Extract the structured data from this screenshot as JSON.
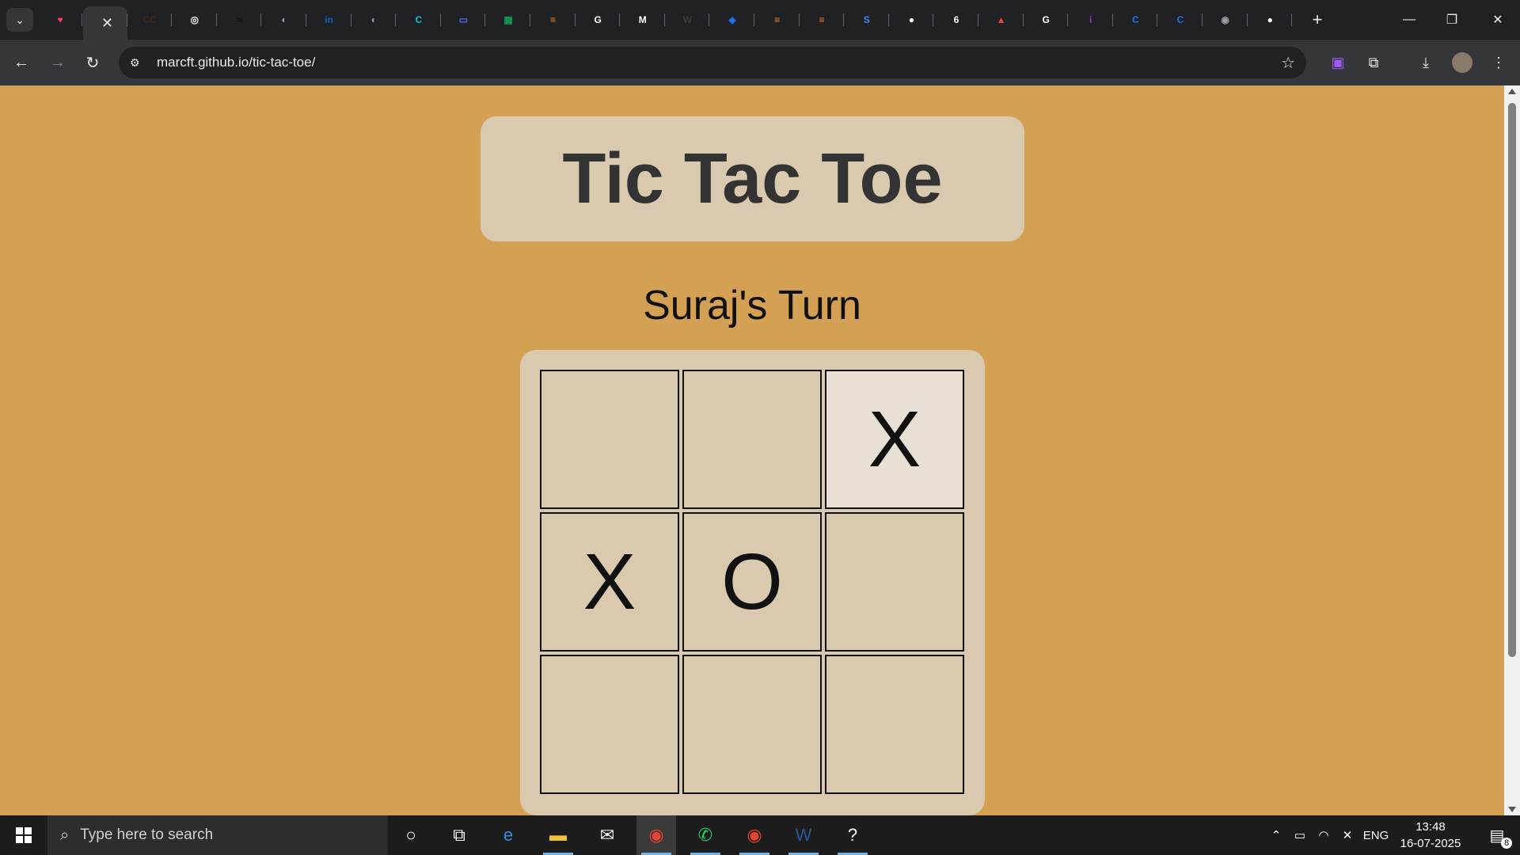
{
  "browser": {
    "url": "marcft.github.io/tic-tac-toe/",
    "tabs": [
      {
        "icon": "pocket-icon",
        "color": "#e8435a",
        "glyph": "♥"
      },
      {
        "icon": "active-tab-close-icon",
        "active": true,
        "glyph": "✕"
      },
      {
        "icon": "cc-icon",
        "color": "#3a2a1a",
        "glyph": "CC"
      },
      {
        "icon": "target-icon",
        "color": "#ffffff",
        "glyph": "◎"
      },
      {
        "icon": "brand-icon",
        "color": "#111111",
        "glyph": "≈"
      },
      {
        "icon": "globe-icon",
        "color": "#9aa0a6",
        "glyph": "◐"
      },
      {
        "icon": "linkedin-icon",
        "color": "#0a66c2",
        "glyph": "in"
      },
      {
        "icon": "globe-icon",
        "color": "#9aa0a6",
        "glyph": "◐"
      },
      {
        "icon": "canva-icon",
        "color": "#00c4cc",
        "glyph": "C"
      },
      {
        "icon": "monitor-icon",
        "color": "#5b6be0",
        "glyph": "▭"
      },
      {
        "icon": "sheets-icon",
        "color": "#0f9d58",
        "glyph": "▦"
      },
      {
        "icon": "stack-icon",
        "color": "#f48024",
        "glyph": "≡"
      },
      {
        "icon": "google-icon",
        "color": "#ffffff",
        "glyph": "G"
      },
      {
        "icon": "gmail-icon",
        "color": "#ffffff",
        "glyph": "M"
      },
      {
        "icon": "w-icon",
        "color": "#3a3a3a",
        "glyph": "W"
      },
      {
        "icon": "bookmark-icon",
        "color": "#1a73e8",
        "glyph": "◆"
      },
      {
        "icon": "stack-icon",
        "color": "#f48024",
        "glyph": "≡"
      },
      {
        "icon": "stack-icon",
        "color": "#f48024",
        "glyph": "≡"
      },
      {
        "icon": "s-icon",
        "color": "#4285f4",
        "glyph": "S"
      },
      {
        "icon": "github-icon",
        "color": "#ffffff",
        "glyph": "●"
      },
      {
        "icon": "six-icon",
        "color": "#ffffff",
        "glyph": "6"
      },
      {
        "icon": "flame-icon",
        "color": "#e8453c",
        "glyph": "▲"
      },
      {
        "icon": "google-icon",
        "color": "#ffffff",
        "glyph": "G"
      },
      {
        "icon": "info-icon",
        "color": "#8e44ad",
        "glyph": "i"
      },
      {
        "icon": "c-icon",
        "color": "#1a73e8",
        "glyph": "C"
      },
      {
        "icon": "c-icon",
        "color": "#1a73e8",
        "glyph": "C"
      },
      {
        "icon": "chrome-icon",
        "color": "#9aa0a6",
        "glyph": "◉"
      },
      {
        "icon": "github-icon",
        "color": "#ffffff",
        "glyph": "●"
      }
    ]
  },
  "game": {
    "title": "Tic Tac Toe",
    "status": "Suraj's Turn",
    "board": [
      "",
      "",
      "X",
      "X",
      "O",
      "",
      "",
      "",
      ""
    ],
    "hovered_cell": 2
  },
  "taskbar": {
    "search_placeholder": "Type here to search",
    "language": "ENG",
    "time": "13:48",
    "date": "16-07-2025",
    "notification_count": "8"
  }
}
